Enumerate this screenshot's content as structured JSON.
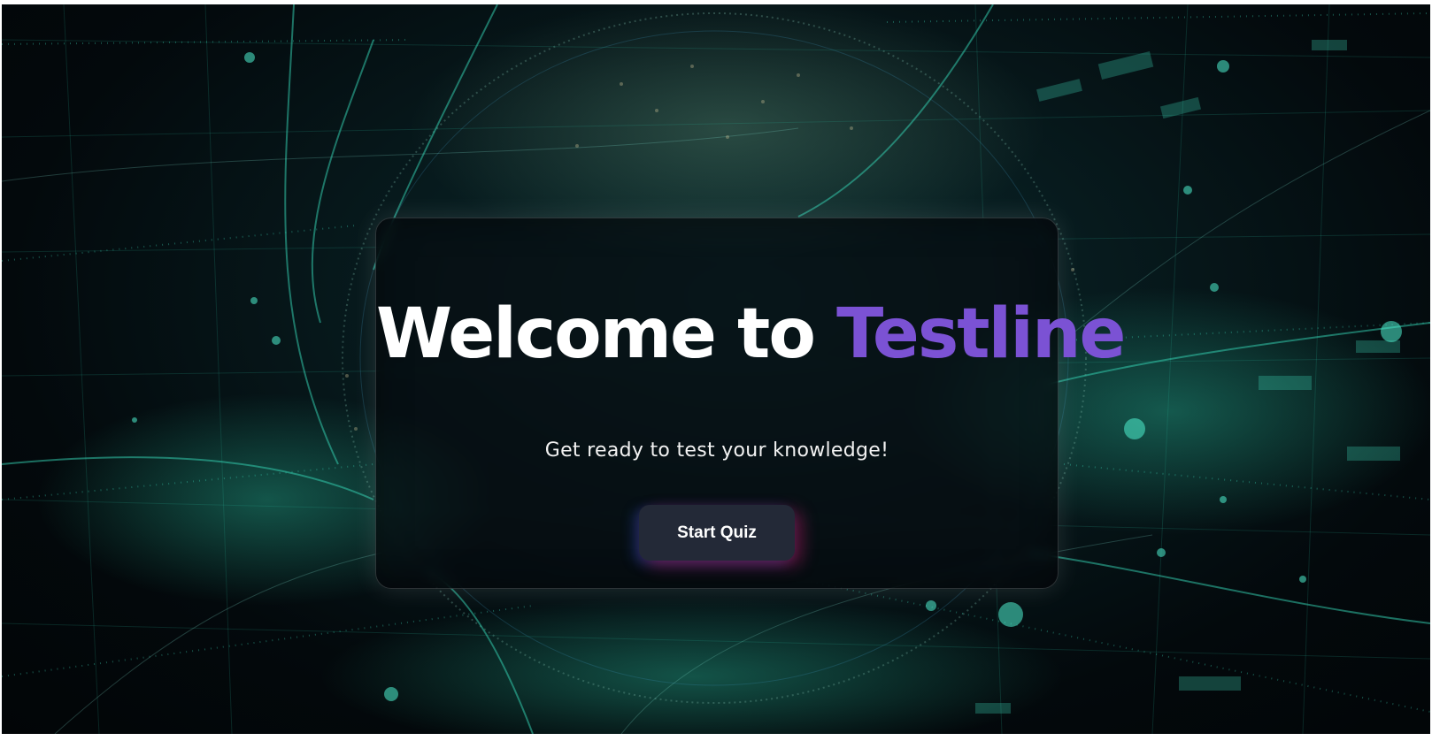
{
  "hero": {
    "title_prefix": "Welcome to ",
    "title_brand": "Testline",
    "subtitle": "Get ready to test your knowledge!"
  },
  "actions": {
    "start_label": "Start Quiz"
  },
  "colors": {
    "brand_accent": "#7b52d4",
    "button_bg": "#232937",
    "background_glow": "#1fb89a"
  }
}
